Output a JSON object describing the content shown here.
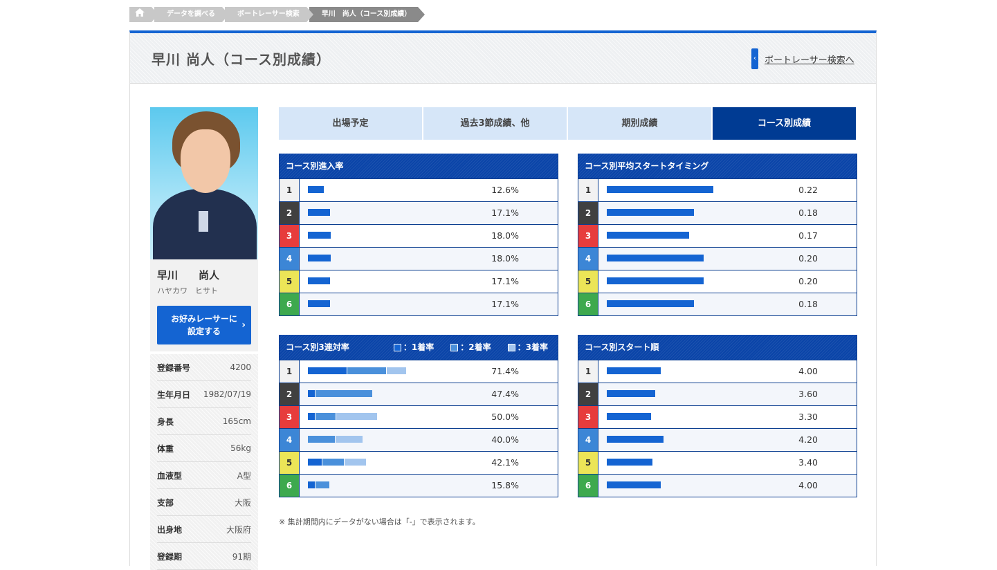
{
  "breadcrumb": [
    "データを調べる",
    "ボートレーサー検索",
    "早川　尚人（コース別成績）"
  ],
  "page": {
    "title": "早川 尚人（コース別成績）",
    "back_link": "ボートレーサー検索へ"
  },
  "profile": {
    "name": "早川　　尚人",
    "kana": "ハヤカワ　ヒサト",
    "fav_button": [
      "お好みレーサーに",
      "設定する"
    ],
    "details": [
      {
        "label": "登録番号",
        "value": "4200"
      },
      {
        "label": "生年月日",
        "value": "1982/07/19"
      },
      {
        "label": "身長",
        "value": "165cm"
      },
      {
        "label": "体重",
        "value": "56kg"
      },
      {
        "label": "血液型",
        "value": "A型"
      },
      {
        "label": "支部",
        "value": "大阪"
      },
      {
        "label": "出身地",
        "value": "大阪府"
      },
      {
        "label": "登録期",
        "value": "91期"
      }
    ]
  },
  "tabs": [
    {
      "label": "出場予定",
      "active": false
    },
    {
      "label": "過去3節成績、他",
      "active": false
    },
    {
      "label": "期別成績",
      "active": false
    },
    {
      "label": "コース別成績",
      "active": true
    }
  ],
  "tables": {
    "entry_rate": {
      "title": "コース別進入率",
      "rows": [
        {
          "course": "1",
          "value": "12.6%",
          "bars": [
            12.6
          ]
        },
        {
          "course": "2",
          "value": "17.1%",
          "bars": [
            17.1
          ]
        },
        {
          "course": "3",
          "value": "18.0%",
          "bars": [
            18.0
          ]
        },
        {
          "course": "4",
          "value": "18.0%",
          "bars": [
            18.0
          ]
        },
        {
          "course": "5",
          "value": "17.1%",
          "bars": [
            17.1
          ]
        },
        {
          "course": "6",
          "value": "17.1%",
          "bars": [
            17.1
          ]
        }
      ]
    },
    "avg_start": {
      "title": "コース別平均スタートタイミング",
      "rows": [
        {
          "course": "1",
          "value": "0.22",
          "bars": [
            0.22
          ]
        },
        {
          "course": "2",
          "value": "0.18",
          "bars": [
            0.18
          ]
        },
        {
          "course": "3",
          "value": "0.17",
          "bars": [
            0.17
          ]
        },
        {
          "course": "4",
          "value": "0.20",
          "bars": [
            0.2
          ]
        },
        {
          "course": "5",
          "value": "0.20",
          "bars": [
            0.2
          ]
        },
        {
          "course": "6",
          "value": "0.18",
          "bars": [
            0.18
          ]
        }
      ]
    },
    "top3_rate": {
      "title": "コース別3連対率",
      "legend": [
        "：1着率",
        "：2着率",
        "：3着率"
      ],
      "rows": [
        {
          "course": "1",
          "value": "71.4%",
          "bars": [
            28.6,
            28.6,
            14.2
          ]
        },
        {
          "course": "2",
          "value": "47.4%",
          "bars": [
            5.3,
            42.1,
            0
          ]
        },
        {
          "course": "3",
          "value": "50.0%",
          "bars": [
            5.0,
            15.0,
            30.0
          ]
        },
        {
          "course": "4",
          "value": "40.0%",
          "bars": [
            0,
            20.0,
            20.0
          ]
        },
        {
          "course": "5",
          "value": "42.1%",
          "bars": [
            10.5,
            15.8,
            15.8
          ]
        },
        {
          "course": "6",
          "value": "15.8%",
          "bars": [
            5.3,
            10.5,
            0
          ]
        }
      ]
    },
    "start_order": {
      "title": "コース別スタート順",
      "rows": [
        {
          "course": "1",
          "value": "4.00",
          "bars": [
            4.0
          ]
        },
        {
          "course": "2",
          "value": "3.60",
          "bars": [
            3.6
          ]
        },
        {
          "course": "3",
          "value": "3.30",
          "bars": [
            3.3
          ]
        },
        {
          "course": "4",
          "value": "4.20",
          "bars": [
            4.2
          ]
        },
        {
          "course": "5",
          "value": "3.40",
          "bars": [
            3.4
          ]
        },
        {
          "course": "6",
          "value": "4.00",
          "bars": [
            4.0
          ]
        }
      ]
    }
  },
  "note": "※ 集計期間内にデータがない場合は「-」で表示されます。",
  "colors": {
    "primary": "#1464d2",
    "tab_active": "#003b93",
    "table_head": "#0a44a8"
  }
}
